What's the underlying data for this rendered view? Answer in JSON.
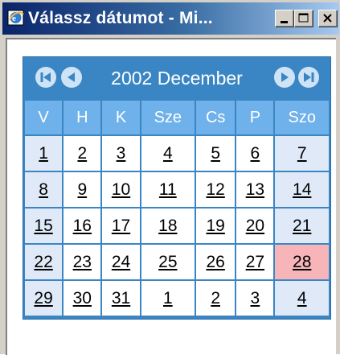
{
  "window": {
    "title": "Válassz dátumot - Mi..."
  },
  "calendar": {
    "month_label": "2002 December",
    "weekdays": [
      "V",
      "H",
      "K",
      "Sze",
      "Cs",
      "P",
      "Szo"
    ],
    "weeks": [
      [
        "1",
        "2",
        "3",
        "4",
        "5",
        "6",
        "7"
      ],
      [
        "8",
        "9",
        "10",
        "11",
        "12",
        "13",
        "14"
      ],
      [
        "15",
        "16",
        "17",
        "18",
        "19",
        "20",
        "21"
      ],
      [
        "22",
        "23",
        "24",
        "25",
        "26",
        "27",
        "28"
      ],
      [
        "29",
        "30",
        "31",
        "1",
        "2",
        "3",
        "4"
      ]
    ],
    "today": "28",
    "colors": {
      "header": "#3a86c4",
      "weekday_row": "#6fb1ea",
      "weekend_cell": "#dfe9f7",
      "today_cell": "#f7b5b9"
    }
  }
}
